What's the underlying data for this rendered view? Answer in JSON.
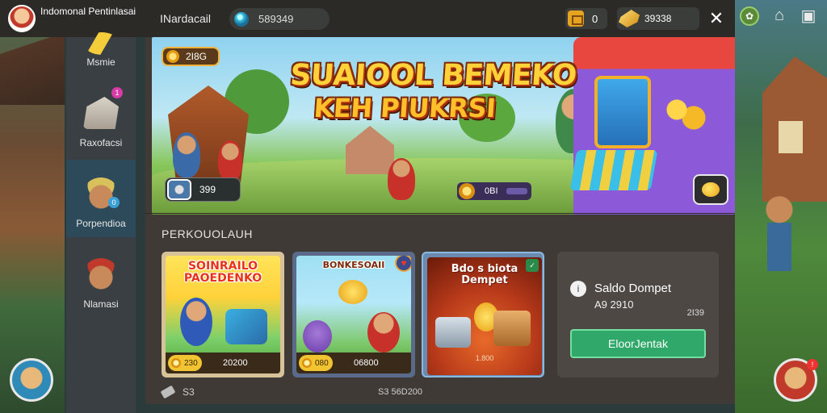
{
  "app": {
    "title": "Indomonal Pentinlasai"
  },
  "header": {
    "section_title": "INardacail",
    "gems": "589349",
    "mail_count": "0",
    "gold": "39338",
    "close_icon": "close-icon"
  },
  "sidebar": {
    "items": [
      {
        "label": "Msmie",
        "icon": "banana-icon"
      },
      {
        "label": "Raxofacsi",
        "icon": "chest-icon",
        "badge": "1"
      },
      {
        "label": "Porpendioa",
        "icon": "character-face-icon",
        "badge": "0"
      },
      {
        "label": "Nlamasi",
        "icon": "character-face-icon"
      }
    ]
  },
  "banner": {
    "title_line1": "SUAIOOL BEMEKO",
    "title_line2": "KEH PIUKRSI",
    "coin_value": "2I8G",
    "player_value": "399",
    "score_value": "0BI"
  },
  "section": {
    "heading": "PERKOUOLAUH"
  },
  "cards": [
    {
      "title": "SOINRAILO PAOEDENKO",
      "price": "230",
      "value": "20200"
    },
    {
      "title": "BONKESOAII",
      "price": "080",
      "value": "06800"
    },
    {
      "title": "Bdo s biota Dempet",
      "caption": "1.800"
    }
  ],
  "wallet": {
    "title": "Saldo Dompet",
    "balance": "A9 2910",
    "secondary": "2I39",
    "button_label": "EloorJentak"
  },
  "footer": {
    "left_value": "S3",
    "mid_value": "S3 56D200"
  },
  "colors": {
    "accent_green": "#2fa86a",
    "gold": "#f2c432",
    "title_yellow": "#ffd23a"
  }
}
